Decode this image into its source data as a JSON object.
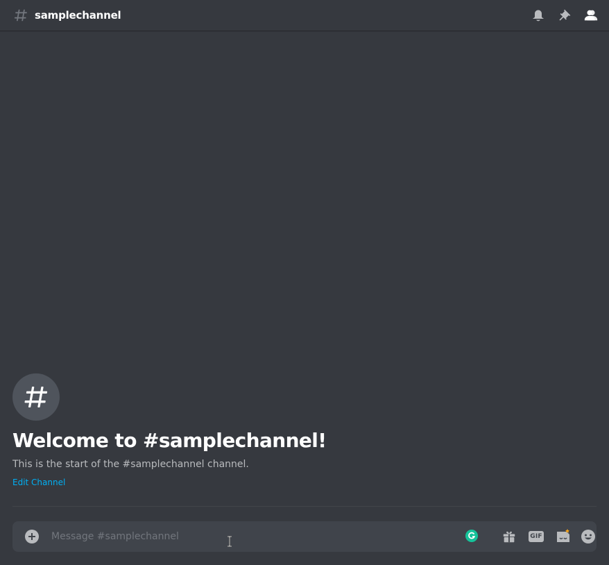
{
  "header": {
    "channel_name": "samplechannel",
    "tools": [
      {
        "name": "notification-bell-icon"
      },
      {
        "name": "pin-icon"
      },
      {
        "name": "member-list-icon"
      }
    ]
  },
  "welcome": {
    "title": "Welcome to #samplechannel!",
    "subtitle": "This is the start of the #samplechannel channel.",
    "edit_link": "Edit Channel"
  },
  "composer": {
    "placeholder": "Message #samplechannel",
    "value": "",
    "gif_label": "GIF",
    "tools": [
      "gift-icon",
      "gif-icon",
      "sticker-icon",
      "emoji-icon"
    ]
  },
  "colors": {
    "background": "#36393f",
    "composer": "#40444b",
    "link": "#00b0f4",
    "grammarly": "#15c39a",
    "sticker_badge": "#faa61a"
  }
}
